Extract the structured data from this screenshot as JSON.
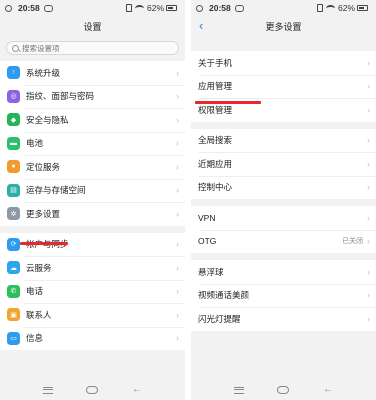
{
  "left": {
    "status": {
      "time": "20:58",
      "battery": "62%"
    },
    "title": "设置",
    "search": {
      "placeholder": "搜索设置项"
    },
    "groups": [
      [
        {
          "label": "系统升级",
          "icon": "system-upgrade-icon",
          "color": "#2d9cf0"
        },
        {
          "label": "指纹、面部与密码",
          "icon": "fingerprint-icon",
          "color": "#8a63e6"
        },
        {
          "label": "安全与隐私",
          "icon": "shield-icon",
          "color": "#27b35a"
        },
        {
          "label": "电池",
          "icon": "battery-icon",
          "color": "#2cbf6e"
        },
        {
          "label": "定位服务",
          "icon": "location-icon",
          "color": "#f29b2c"
        },
        {
          "label": "运存与存储空间",
          "icon": "storage-icon",
          "color": "#2bb0a8"
        },
        {
          "label": "更多设置",
          "icon": "gear-icon",
          "color": "#8e9aa6"
        }
      ],
      [
        {
          "label": "帐户与同步",
          "icon": "sync-icon",
          "color": "#2d9cf0"
        },
        {
          "label": "云服务",
          "icon": "cloud-icon",
          "color": "#2aa6ee"
        },
        {
          "label": "电话",
          "icon": "phone-icon",
          "color": "#2cbf5a"
        },
        {
          "label": "联系人",
          "icon": "contacts-icon",
          "color": "#f2a42c"
        },
        {
          "label": "信息",
          "icon": "message-icon",
          "color": "#2d9cf0"
        }
      ]
    ]
  },
  "right": {
    "status": {
      "time": "20:58",
      "battery": "62%"
    },
    "title": "更多设置",
    "groups": [
      [
        {
          "label": "关于手机"
        },
        {
          "label": "应用管理"
        },
        {
          "label": "权限管理"
        }
      ],
      [
        {
          "label": "全局搜索"
        },
        {
          "label": "近期应用"
        },
        {
          "label": "控制中心"
        }
      ],
      [
        {
          "label": "VPN"
        },
        {
          "label": "OTG",
          "value": "已关闭"
        }
      ],
      [
        {
          "label": "悬浮球"
        },
        {
          "label": "视频通话美颜"
        },
        {
          "label": "闪光灯提醒"
        }
      ]
    ]
  },
  "accent": "#e8282a"
}
